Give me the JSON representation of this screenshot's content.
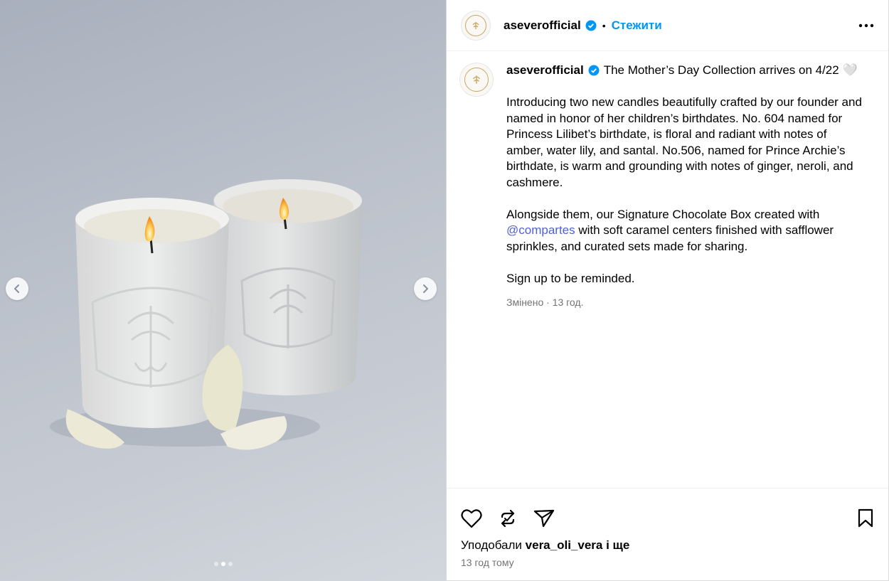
{
  "post": {
    "username": "aseverofficial",
    "follow_label": "Стежити",
    "separator": "•",
    "caption_lines": {
      "title": "The Mother’s Day Collection arrives on 4/22 🤍",
      "p1": "Introducing two new candles beautifully crafted by our founder and named in honor of her children’s birthdates. No. 604 named for Princess Lilibet’s birthdate, is floral and radiant with notes of amber, water lily, and santal. No.506, named for Prince Archie’s birthdate, is warm and grounding with notes of ginger, neroli, and cashmere.",
      "p2_before": "Alongside them, our Signature Chocolate Box created with ",
      "p2_mention": "@compartes",
      "p2_after": " with soft caramel centers finished with safflower sprinkles, and curated sets made for sharing.",
      "p3": "Sign up to be reminded."
    },
    "edited_meta": "Змінено · 13 год.",
    "likes_prefix": "Уподобали",
    "likes_user": "vera_oli_vera",
    "likes_suffix": "і ще",
    "timestamp": "13 год тому"
  },
  "carousel": {
    "current": 2,
    "total": 3
  },
  "icons": {
    "verified": "verified-badge-icon",
    "more": "more-options-icon",
    "like": "heart-icon",
    "repost": "repost-icon",
    "share": "send-icon",
    "save": "bookmark-icon",
    "prev": "chevron-left-icon",
    "next": "chevron-right-icon"
  },
  "colors": {
    "link": "#0095f6",
    "mention": "#4f60d6",
    "muted": "#737373"
  }
}
